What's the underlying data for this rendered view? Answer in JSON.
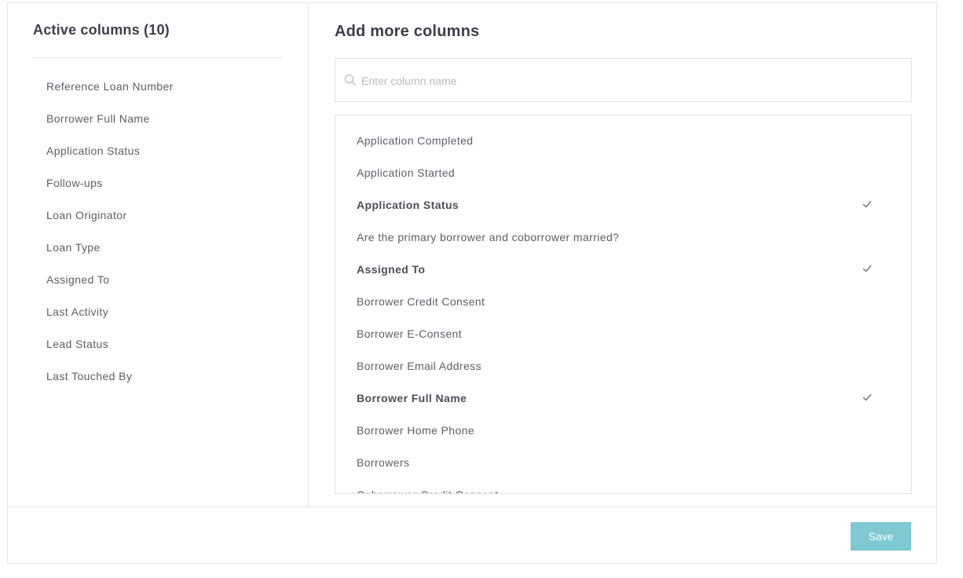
{
  "active_panel": {
    "title": "Active columns (10)",
    "items": [
      "Reference Loan Number",
      "Borrower Full Name",
      "Application Status",
      "Follow-ups",
      "Loan Originator",
      "Loan Type",
      "Assigned To",
      "Last Activity",
      "Lead Status",
      "Last Touched By"
    ]
  },
  "add_panel": {
    "title": "Add more columns",
    "search": {
      "placeholder": "Enter column name",
      "value": "",
      "icon": "search-icon"
    },
    "options": [
      {
        "label": "Application Completed",
        "selected": false
      },
      {
        "label": "Application Started",
        "selected": false
      },
      {
        "label": "Application Status",
        "selected": true
      },
      {
        "label": "Are the primary borrower and coborrower married?",
        "selected": false
      },
      {
        "label": "Assigned To",
        "selected": true
      },
      {
        "label": "Borrower Credit Consent",
        "selected": false
      },
      {
        "label": "Borrower E-Consent",
        "selected": false
      },
      {
        "label": "Borrower Email Address",
        "selected": false
      },
      {
        "label": "Borrower Full Name",
        "selected": true
      },
      {
        "label": "Borrower Home Phone",
        "selected": false
      },
      {
        "label": "Borrowers",
        "selected": false
      },
      {
        "label": "Coborrower Credit Consent",
        "selected": false
      }
    ]
  },
  "footer": {
    "save_label": "Save"
  },
  "colors": {
    "accent": "#7ec9d2",
    "border": "#e3e5e8",
    "text": "#5a5f6a"
  }
}
